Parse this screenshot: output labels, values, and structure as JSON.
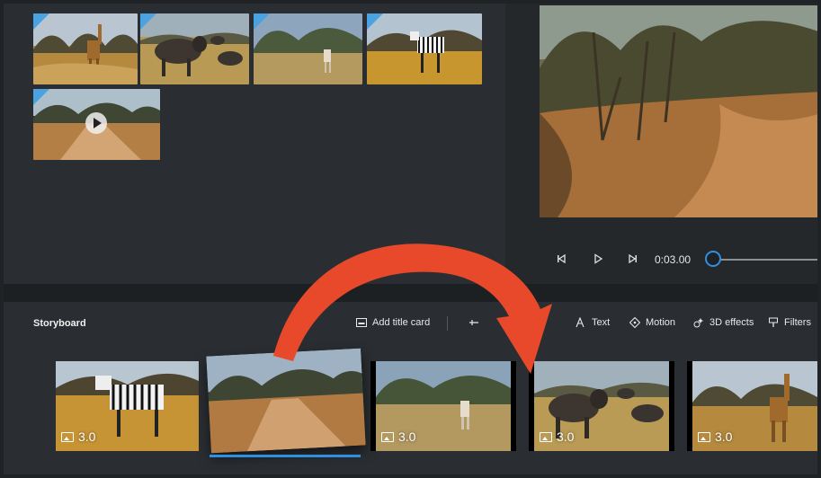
{
  "library": {
    "items": [
      {
        "name": "giraffe"
      },
      {
        "name": "wildebeest"
      },
      {
        "name": "antelope"
      },
      {
        "name": "zebra"
      },
      {
        "name": "dirt-road-video"
      }
    ]
  },
  "player": {
    "timecode": "0:03.00",
    "progress": 0.03
  },
  "storyboard": {
    "title": "Storyboard",
    "tools": {
      "add_title_card": "Add title card",
      "text": "Text",
      "motion": "Motion",
      "effects_3d": "3D effects",
      "filters": "Filters"
    },
    "clips": [
      {
        "scene": "zebra",
        "duration": "3.0"
      },
      {
        "scene": "dirt-road",
        "duration": ""
      },
      {
        "scene": "antelope",
        "duration": "3.0"
      },
      {
        "scene": "wildebeest",
        "duration": "3.0"
      },
      {
        "scene": "giraffe",
        "duration": "3.0"
      }
    ]
  },
  "colors": {
    "accent": "#2f8fe0",
    "annotation_arrow": "#e8492a",
    "background": "#2a2e32"
  },
  "icons": [
    "play-icon",
    "previous-frame-icon",
    "next-frame-icon",
    "title-card-icon",
    "text-icon",
    "motion-icon",
    "effects-3d-icon",
    "filters-icon",
    "image-icon"
  ]
}
